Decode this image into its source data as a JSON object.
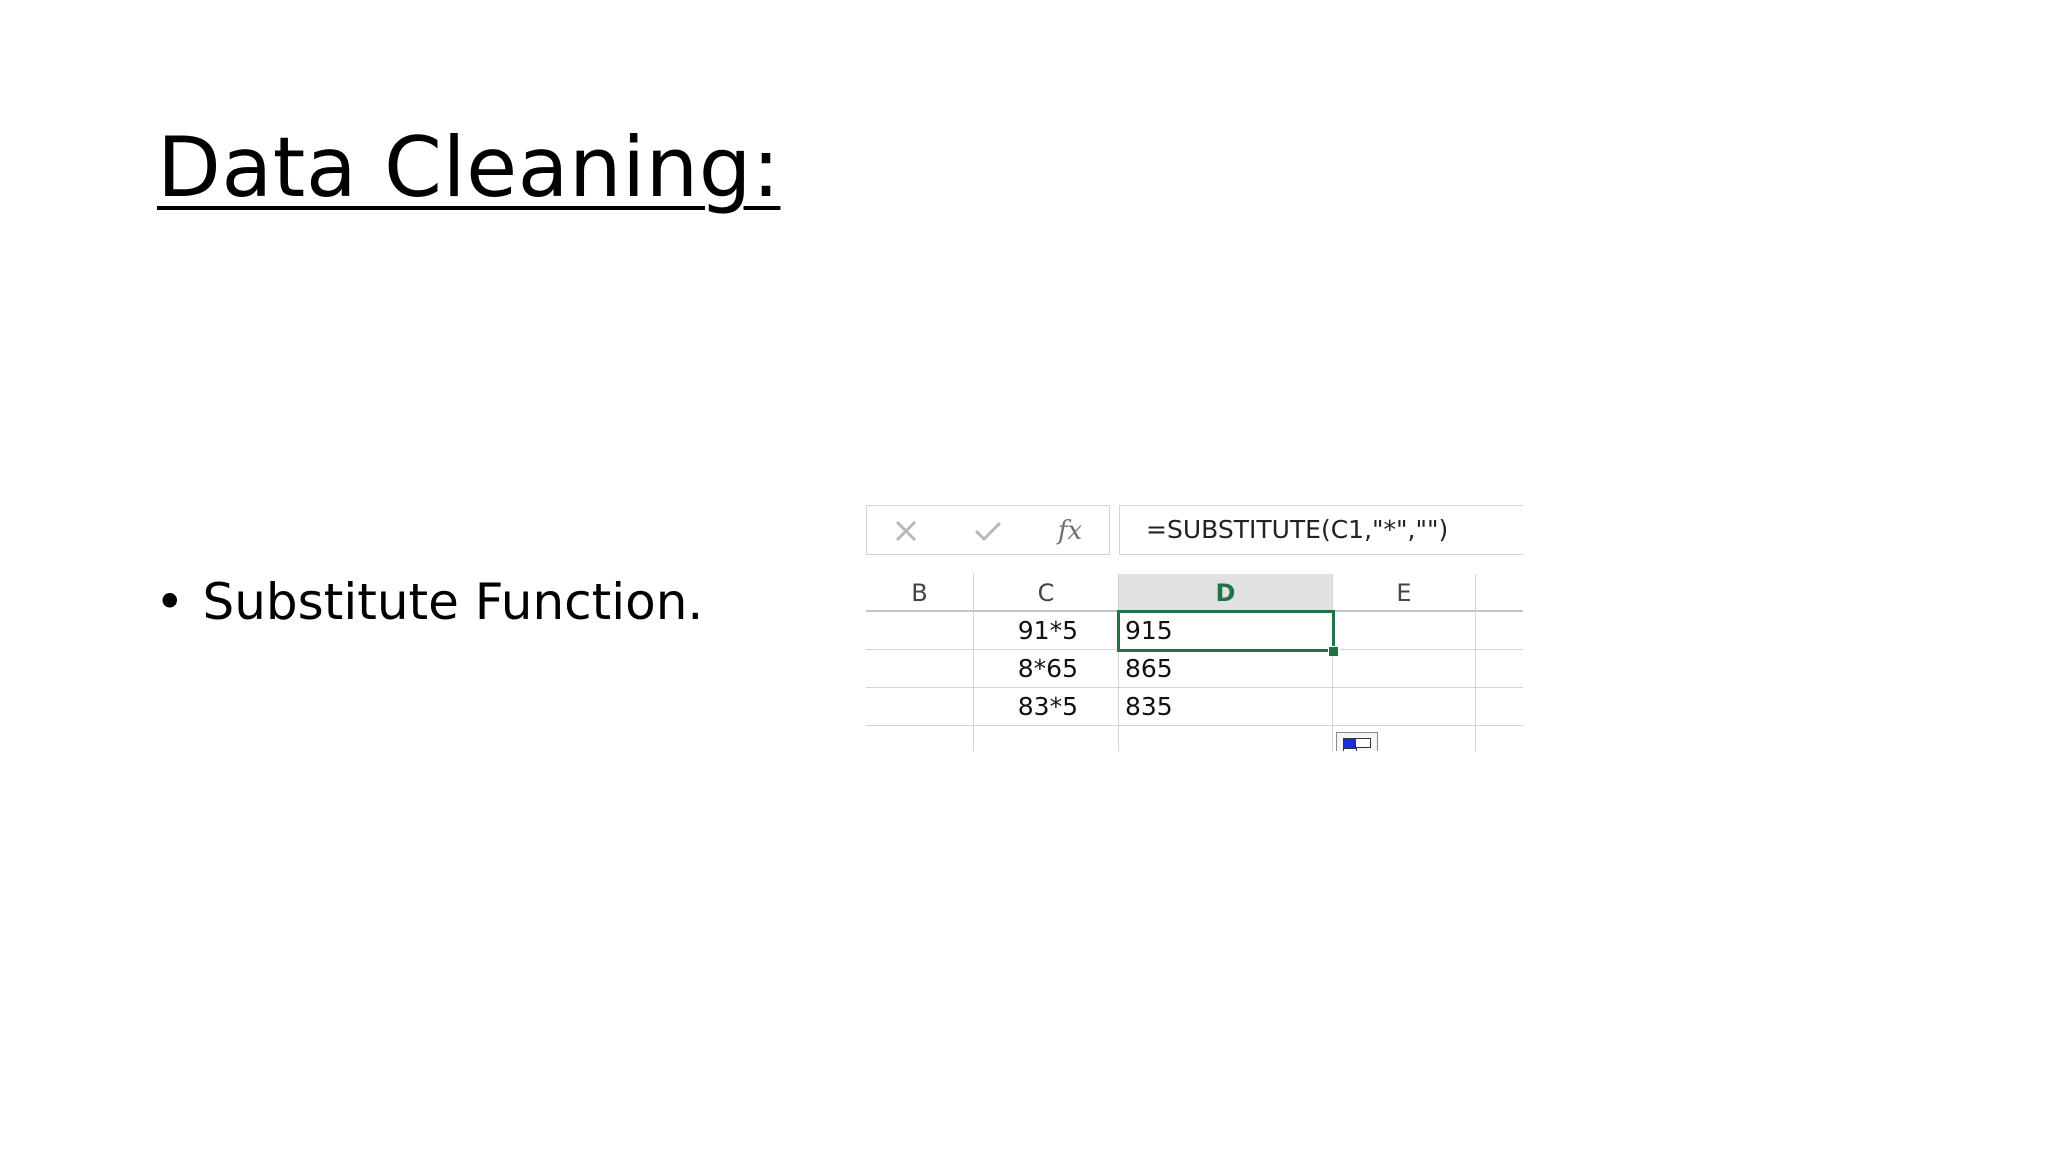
{
  "slide": {
    "title": "Data Cleaning:",
    "bullets": [
      {
        "marker": "•",
        "text": "Substitute Function."
      }
    ]
  },
  "spreadsheet": {
    "formula_bar": {
      "cancel_icon": "close-icon",
      "enter_icon": "check-icon",
      "fx_label": "fx",
      "formula": "=SUBSTITUTE(C1,\"*\",\"\")"
    },
    "columns": [
      "B",
      "C",
      "D",
      "E"
    ],
    "selected_column": "D",
    "rows": [
      {
        "B": "",
        "C": "91*5",
        "D": "915",
        "E": ""
      },
      {
        "B": "",
        "C": "8*65",
        "D": "865",
        "E": ""
      },
      {
        "B": "",
        "C": "83*5",
        "D": "835",
        "E": ""
      }
    ],
    "active_cell": "D1",
    "accent_color": "#217346",
    "paste_options_icon": "paste-options-icon"
  }
}
